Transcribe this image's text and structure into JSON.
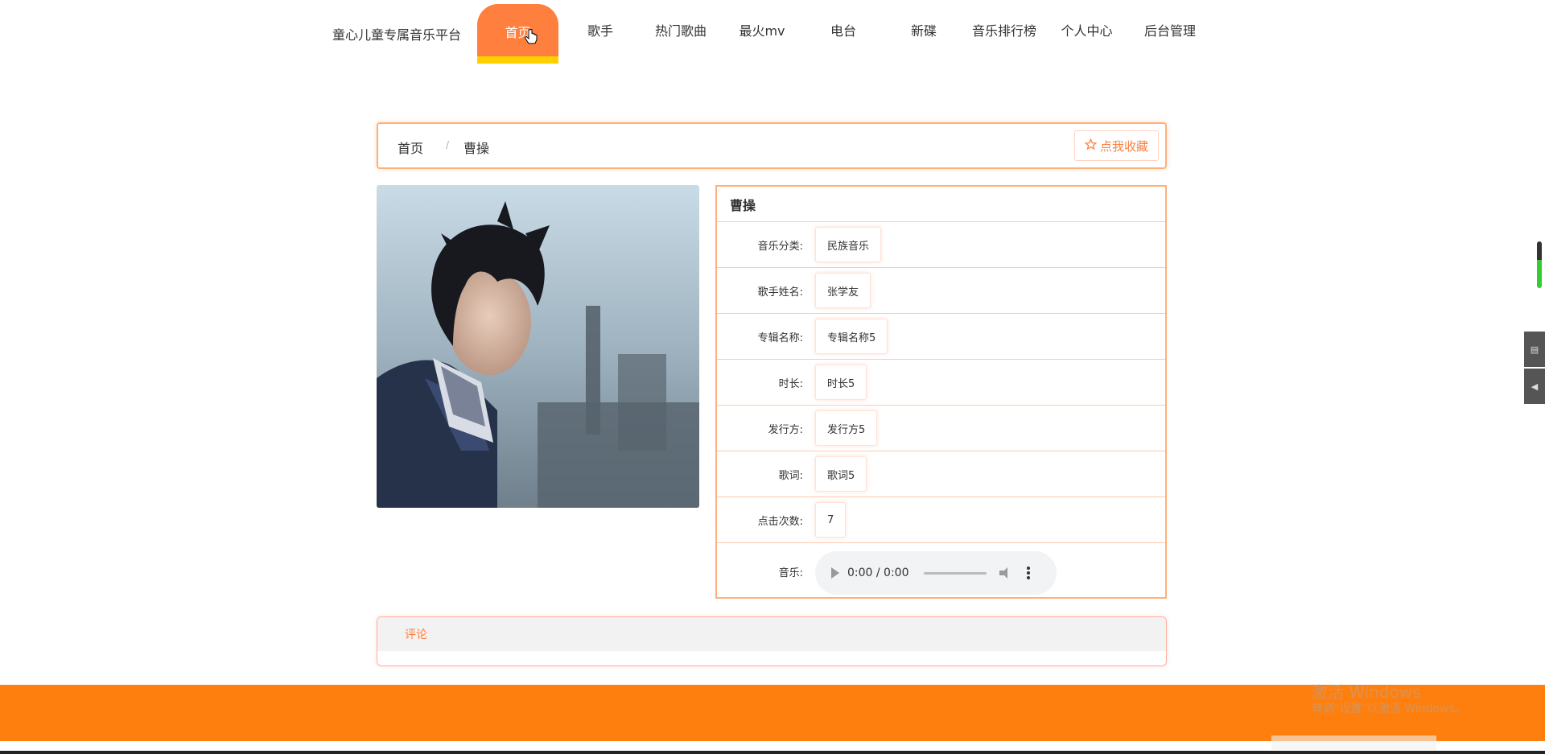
{
  "nav": {
    "site_title": "童心儿童专属音乐平台",
    "items": [
      {
        "label": "首页"
      },
      {
        "label": "歌手"
      },
      {
        "label": "热门歌曲"
      },
      {
        "label": "最火mv"
      },
      {
        "label": "电台"
      },
      {
        "label": "新碟"
      },
      {
        "label": "音乐排行榜"
      },
      {
        "label": "个人中心"
      },
      {
        "label": "后台管理"
      }
    ],
    "active_color": "#ff7f3f",
    "active_underline_color": "#ffd000"
  },
  "breadcrumb": {
    "home": "首页",
    "separator": "/",
    "current": "曹操"
  },
  "favorite_button": {
    "icon": "star-outline-icon",
    "label": "点我收藏"
  },
  "detail": {
    "title": "曹操",
    "rows": [
      {
        "label": "音乐分类:",
        "value": "民族音乐"
      },
      {
        "label": "歌手姓名:",
        "value": "张学友"
      },
      {
        "label": "专辑名称:",
        "value": "专辑名称5"
      },
      {
        "label": "时长:",
        "value": "时长5"
      },
      {
        "label": "发行方:",
        "value": "发行方5"
      },
      {
        "label": "歌词:",
        "value": "歌词5"
      },
      {
        "label": "点击次数:",
        "value": "7"
      }
    ],
    "music_label": "音乐:",
    "audio": {
      "time": "0:00 / 0:00"
    }
  },
  "comments": {
    "title": "评论"
  },
  "colors": {
    "accent": "#ff7f3f",
    "footer": "#ff7f0e",
    "border": "#ffb07a"
  },
  "watermark": {
    "line1": "激活 Windows",
    "line2": "转到\"设置\"以激活 Windows。"
  }
}
